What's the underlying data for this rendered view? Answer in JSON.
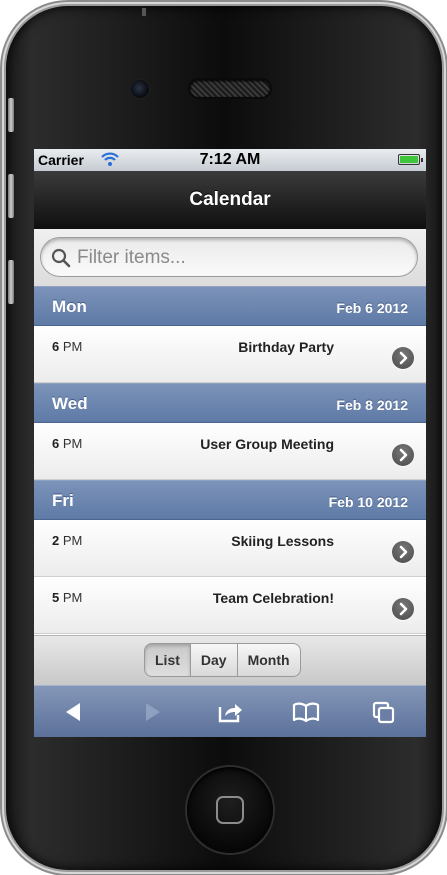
{
  "status_bar": {
    "carrier": "Carrier",
    "time": "7:12 AM"
  },
  "nav": {
    "title": "Calendar"
  },
  "search": {
    "placeholder": "Filter items..."
  },
  "days": [
    {
      "day": "Mon",
      "date": "Feb 6 2012",
      "events": [
        {
          "hour": "6",
          "period": "PM",
          "title": "Birthday Party"
        }
      ]
    },
    {
      "day": "Wed",
      "date": "Feb 8 2012",
      "events": [
        {
          "hour": "6",
          "period": "PM",
          "title": "User Group Meeting"
        }
      ]
    },
    {
      "day": "Fri",
      "date": "Feb 10 2012",
      "events": [
        {
          "hour": "2",
          "period": "PM",
          "title": "Skiing Lessons"
        },
        {
          "hour": "5",
          "period": "PM",
          "title": "Team Celebration!"
        }
      ]
    }
  ],
  "view_switcher": {
    "options": [
      "List",
      "Day",
      "Month"
    ],
    "selected": "List"
  },
  "toolbar": {
    "icons": [
      "back-arrow-icon",
      "forward-arrow-icon",
      "share-icon",
      "bookmarks-icon",
      "tabs-icon"
    ]
  },
  "colors": {
    "day_header": "#6b84ad",
    "toolbar": "#6d81a8",
    "battery": "#3fc53a"
  }
}
